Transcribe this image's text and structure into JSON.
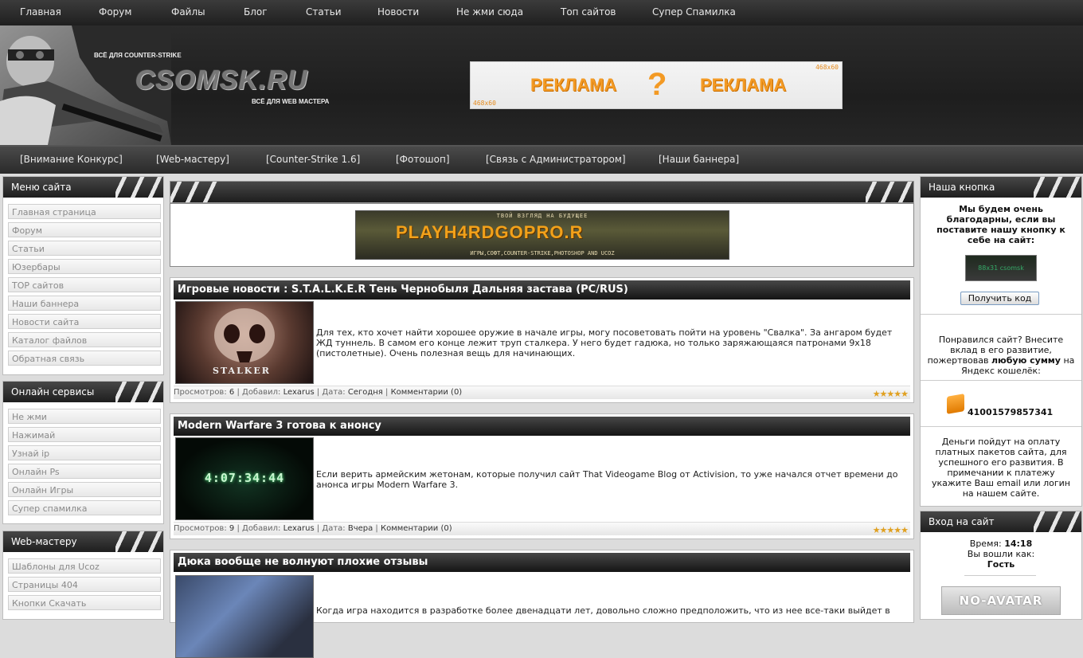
{
  "topnav": [
    "Главная",
    "Форум",
    "Файлы",
    "Блог",
    "Статьи",
    "Новости",
    "Не жми сюда",
    "Топ сайтов",
    "Супер Спамилка"
  ],
  "header": {
    "logo_top": "ВСЁ ДЛЯ COUNTER-STRIKE",
    "logo": "CSOMSK.RU",
    "logo_bottom": "ВСЁ ДЛЯ WEB МАСТЕРА",
    "ad": {
      "size_top": "468x60",
      "size_bottom": "468x60",
      "word_left": "РЕКЛАМА",
      "word_right": "РЕКЛАМА",
      "q": "?"
    }
  },
  "secnav": [
    "[Внимание Конкурс]",
    "[Web-мастеру]",
    "[Counter-Strike 1.6]",
    "[Фотошоп]",
    "[Связь с Администратором]",
    "[Наши баннера]"
  ],
  "left": {
    "menu": {
      "title": "Меню сайта",
      "items": [
        "Главная страница",
        "Форум",
        "Статьи",
        "Юзербары",
        "TOP сайтов",
        "Наши баннера",
        "Новости сайта",
        "Каталог файлов",
        "Обратная связь"
      ]
    },
    "online": {
      "title": "Онлайн сервисы",
      "items": [
        "Не жми",
        "Нажимай",
        "Узнай ip",
        "Онлайн Ps",
        "Онлайн Игры",
        "Супер спамилка"
      ]
    },
    "web": {
      "title": "Web-мастеру",
      "items": [
        "Шаблоны для Ucoz",
        "Страницы 404",
        "Кнопки Скачать"
      ]
    }
  },
  "banner": {
    "top": "ТВОЙ ВЗГЛЯД НА БУДУЩЕЕ",
    "logo": "PLAYH4RDGOPRO.R",
    "bottom": "ИГРЫ,СОФТ,COUNTER-STRIKE,PHOTOSHOP AND UCOZ"
  },
  "posts": [
    {
      "title": "Игровые новости : S.T.A.L.K.E.R Тень Чернобыля Дальняя застава (PC/RUS)",
      "text": "Для тех, кто хочет найти хорошее оружие в начале игры, могу посоветовать пойти на уровень \"Свалка\". За ангаром будет ЖД туннель. В самом его конце лежит труп сталкера. У него будет гадюка, но только заряжающаяся патронами 9x18 (пистолетные). Очень полезная вещь для начинающих.",
      "image_label": "STALKER",
      "views_label": "Просмотров:",
      "views": "6",
      "author_label": "Добавил:",
      "author": "Lexarus",
      "date_label": "Дата:",
      "date": "Сегодня",
      "comments": "Комментарии (0)",
      "rating": "★★★★★"
    },
    {
      "title": "Modern Warfare 3 готова к анонсу",
      "text": "Если верить армейским жетонам, которые получил сайт That Videogame Blog от Activision, то уже начался отчет времени до анонса игры Modern Warfare 3.",
      "image_label": "4:07:34:44",
      "views_label": "Просмотров:",
      "views": "9",
      "author_label": "Добавил:",
      "author": "Lexarus",
      "date_label": "Дата:",
      "date": "Вчера",
      "comments": "Комментарии (0)",
      "rating": "★★★★★"
    },
    {
      "title": "Дюка вообще не волнуют плохие отзывы",
      "text": "Когда игра находится в разработке более двенадцати лет, довольно сложно предположить, что из нее все-таки выйдет в"
    }
  ],
  "right": {
    "button_block": {
      "title": "Наша кнопка",
      "text": "Мы будем очень благодарны, если вы поставите нашу кнопку к себе на сайт:",
      "button_img": "88x31 csomsk",
      "get_code": "Получить код",
      "donate": "Понравился сайт? Внесите вклад в его развитие, пожертвовав",
      "donate_bold": "любую сумму",
      "donate_tail": "на Яндекс кошелёк:",
      "wallet": "41001579857341",
      "note": "Деньги пойдут на оплату платных пакетов сайта, для успешного его развития. В примечании к платежу укажите Ваш email или логин на нашем сайте."
    },
    "login": {
      "title": "Вход на сайт",
      "time_label": "Время:",
      "time": "14:18",
      "logged_label": "Вы вошли как:",
      "user": "Гость",
      "avatar": "NO-AVATAR"
    }
  }
}
